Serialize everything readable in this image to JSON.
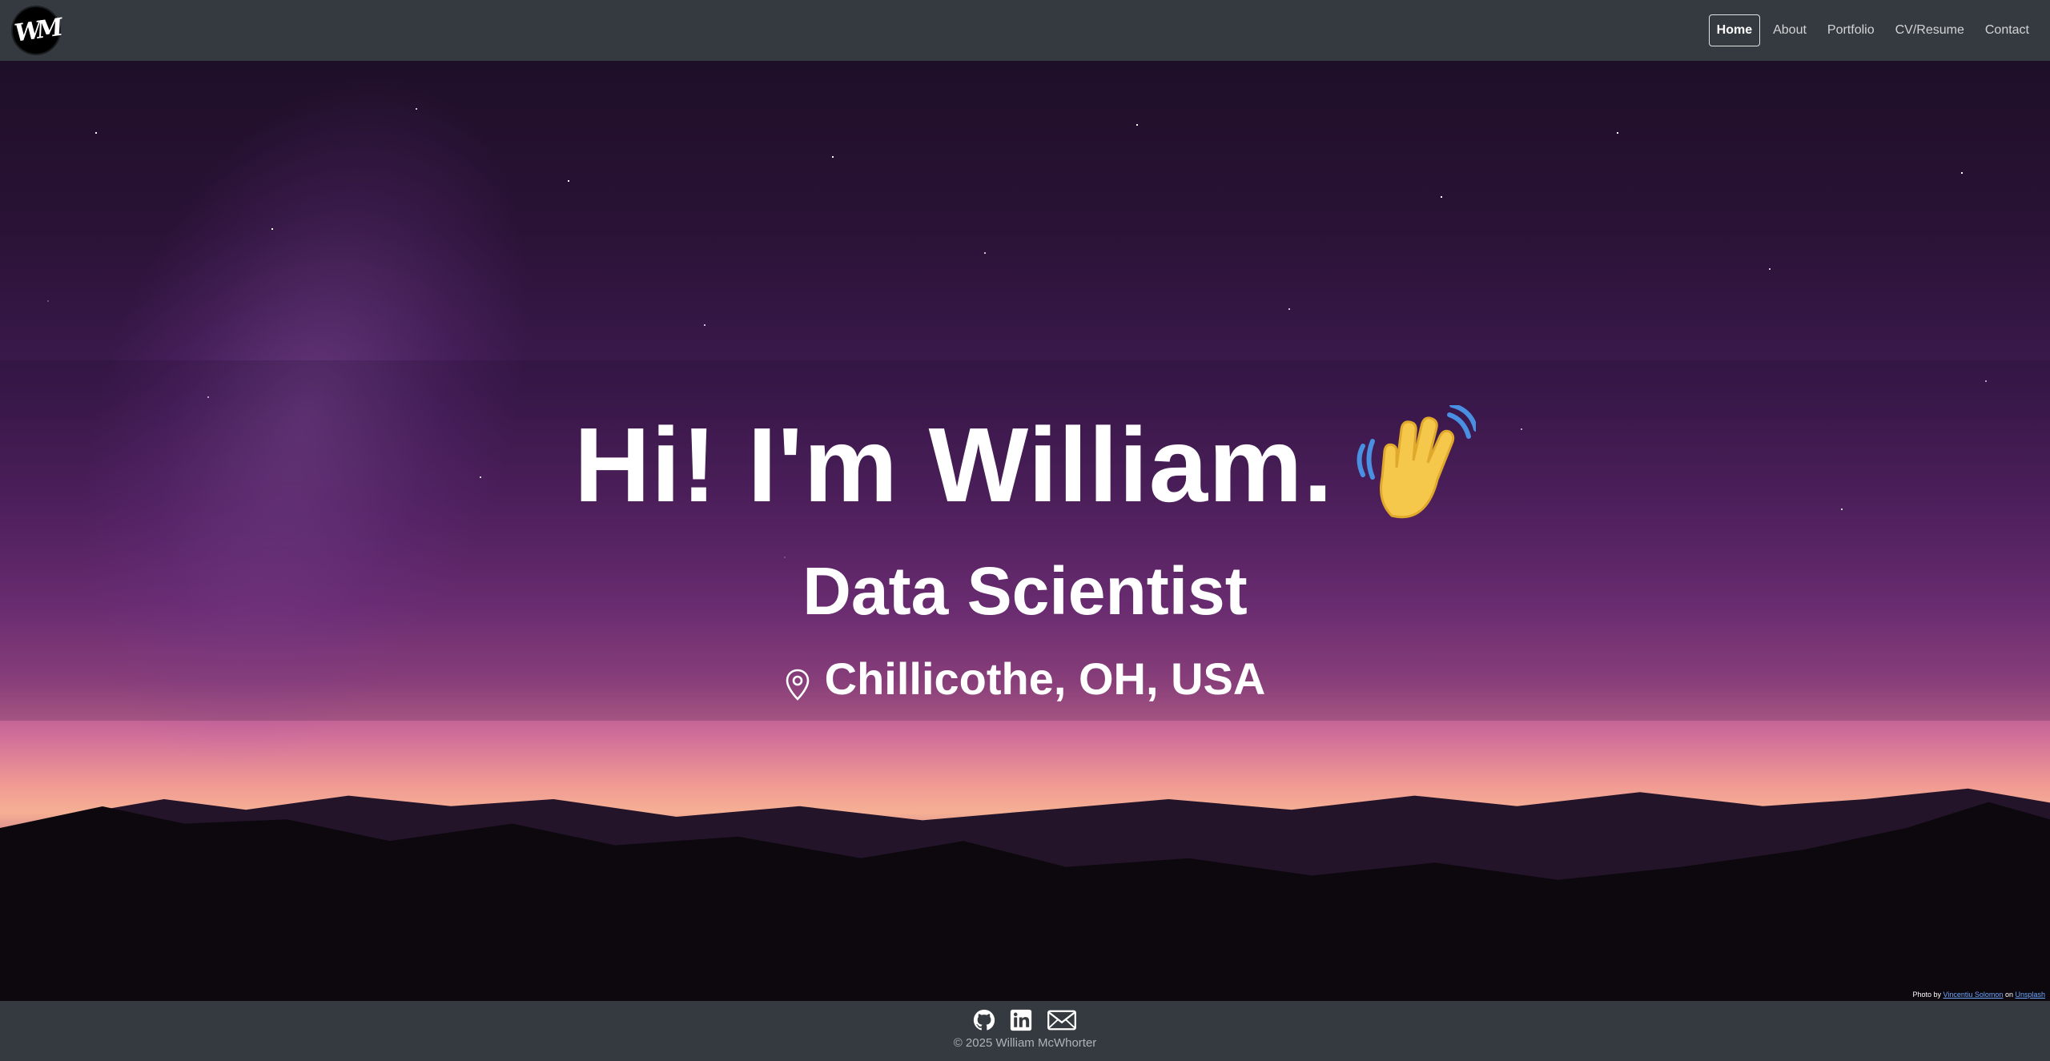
{
  "navbar": {
    "logo_text": "WM",
    "items": [
      {
        "label": "Home",
        "active": true
      },
      {
        "label": "About"
      },
      {
        "label": "Portfolio"
      },
      {
        "label": "CV/Resume"
      },
      {
        "label": "Contact"
      }
    ]
  },
  "hero": {
    "title": "Hi! I'm William.",
    "title_icon": "waving-hand-icon",
    "subtitle": "Data Scientist",
    "location_icon": "map-pin-icon",
    "location": "Chillicothe, OH, USA"
  },
  "photo_credit": {
    "prefix": "Photo by",
    "author": "Vincentiu Solomon",
    "middle": "on",
    "source": "Unsplash"
  },
  "footer": {
    "icons": [
      "github-icon",
      "linkedin-icon",
      "email-icon"
    ],
    "copyright": "© 2025 William McWhorter"
  },
  "colors": {
    "navbar_bg": "#343a40",
    "link_accent": "#6ea8ff"
  }
}
